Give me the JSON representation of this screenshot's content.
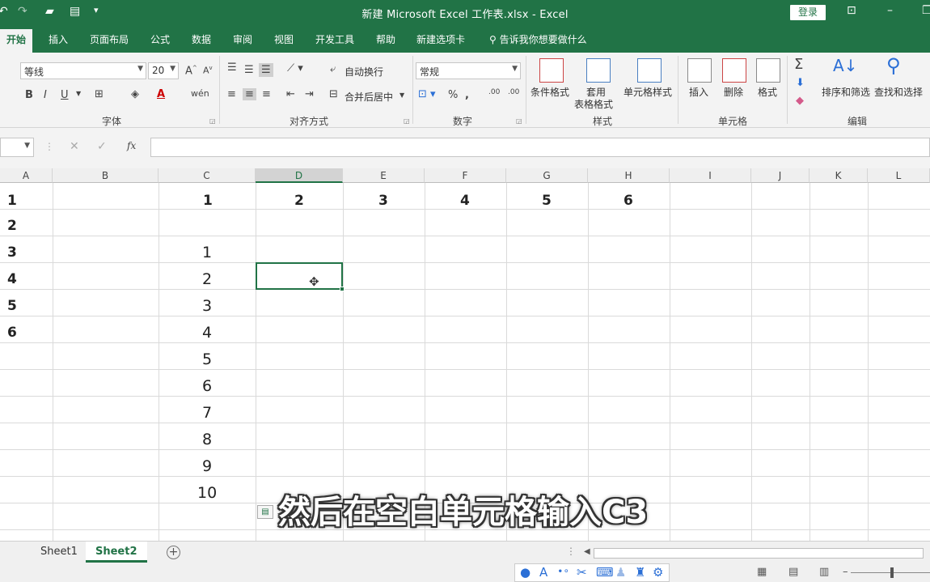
{
  "titlebar": {
    "title": "新建 Microsoft Excel 工作表.xlsx  -  Excel",
    "login": "登录"
  },
  "tabs": [
    "开始",
    "插入",
    "页面布局",
    "公式",
    "数据",
    "审阅",
    "视图",
    "开发工具",
    "帮助",
    "新建选项卡"
  ],
  "tell_me": "告诉我你想要做什么",
  "ribbon": {
    "font_name": "等线",
    "font_size": "20",
    "wrap_text": "自动换行",
    "merge_center": "合并后居中",
    "number_format": "常规",
    "conditional_format": "条件格式",
    "table_format_1": "套用",
    "table_format_2": "表格格式",
    "cell_styles": "单元格样式",
    "insert": "插入",
    "delete": "删除",
    "format": "格式",
    "sort_filter": "排序和筛选",
    "find_select": "查找和选择",
    "group_font": "字体",
    "group_align": "对齐方式",
    "group_number": "数字",
    "group_styles": "样式",
    "group_cells": "单元格",
    "group_edit": "编辑"
  },
  "formula_bar": {
    "fx": "fx",
    "content": ""
  },
  "columns": [
    "A",
    "B",
    "C",
    "D",
    "E",
    "F",
    "G",
    "H",
    "I",
    "J",
    "K",
    "L"
  ],
  "selected_column": "D",
  "cells": {
    "A1": "1",
    "A2": "2",
    "A3": "3",
    "A4": "4",
    "A5": "5",
    "A6": "6",
    "C1": "1",
    "D1": "2",
    "E1": "3",
    "F1": "4",
    "G1": "5",
    "H1": "6",
    "C3": "1",
    "C4": "2",
    "C5": "3",
    "C6": "4",
    "C7": "5",
    "C8": "6",
    "C9": "7",
    "C10": "8",
    "C11": "9",
    "C12": "10"
  },
  "subtitle": "然后在空白单元格输入C3",
  "sheets": [
    "Sheet1",
    "Sheet2"
  ],
  "active_sheet": "Sheet2",
  "colors": {
    "accent": "#217346"
  }
}
